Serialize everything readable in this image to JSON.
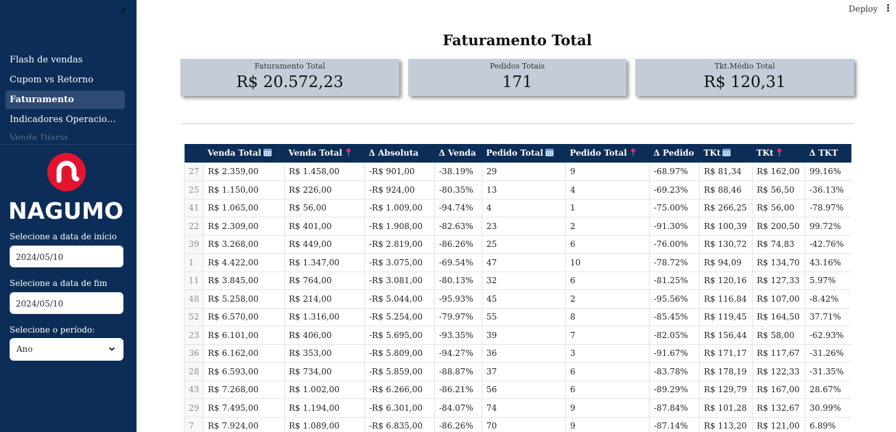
{
  "sidebar": {
    "close_label": "×",
    "nav": [
      {
        "label": "Flash de vendas",
        "active": false
      },
      {
        "label": "Cupom vs Retorno",
        "active": false
      },
      {
        "label": "Faturamento",
        "active": true
      },
      {
        "label": "Indicadores Operacionais ...",
        "active": false
      },
      {
        "label": "Venda Diaria",
        "active": false
      }
    ],
    "logo_text": "NAGUMO",
    "start_date": {
      "label": "Selecione a data de início",
      "value": "2024/05/10"
    },
    "end_date": {
      "label": "Selecione a data de fim",
      "value": "2024/05/10"
    },
    "period": {
      "label": "Selecione o período:",
      "value": "Ano"
    }
  },
  "topbar": {
    "deploy_label": "Deploy",
    "menu_icon": "kebab-menu-icon"
  },
  "page": {
    "title": "Faturamento Total"
  },
  "metrics": [
    {
      "label": "Faturamento Total",
      "value": "R$ 20.572,23"
    },
    {
      "label": "Pedidos Totais",
      "value": "171"
    },
    {
      "label": "Tkt.Médio Total",
      "value": "R$ 120,31"
    }
  ],
  "table": {
    "columns": [
      {
        "label": "Venda Total",
        "icon": "calendar-icon"
      },
      {
        "label": "Venda Total",
        "icon": "pin-icon"
      },
      {
        "label": "Δ Absoluta",
        "icon": ""
      },
      {
        "label": "Δ Venda",
        "icon": ""
      },
      {
        "label": "Pedido Total",
        "icon": "calendar-icon"
      },
      {
        "label": "Pedido Total",
        "icon": "pin-icon"
      },
      {
        "label": "Δ Pedido",
        "icon": ""
      },
      {
        "label": "TKt",
        "icon": "calendar-icon"
      },
      {
        "label": "TKt",
        "icon": "pin-icon"
      },
      {
        "label": "Δ TKT",
        "icon": ""
      }
    ],
    "rows": [
      [
        "27",
        "R$ 2.359,00",
        "R$ 1.458,00",
        "-R$ 901,00",
        "-38.19%",
        "29",
        "9",
        "-68.97%",
        "R$ 81,34",
        "R$ 162,00",
        "99.16%"
      ],
      [
        "25",
        "R$ 1.150,00",
        "R$ 226,00",
        "-R$ 924,00",
        "-80.35%",
        "13",
        "4",
        "-69.23%",
        "R$ 88,46",
        "R$ 56,50",
        "-36.13%"
      ],
      [
        "41",
        "R$ 1.065,00",
        "R$ 56,00",
        "-R$ 1.009,00",
        "-94.74%",
        "4",
        "1",
        "-75.00%",
        "R$ 266,25",
        "R$ 56,00",
        "-78.97%"
      ],
      [
        "22",
        "R$ 2.309,00",
        "R$ 401,00",
        "-R$ 1.908,00",
        "-82.63%",
        "23",
        "2",
        "-91.30%",
        "R$ 100,39",
        "R$ 200,50",
        "99.72%"
      ],
      [
        "39",
        "R$ 3.268,00",
        "R$ 449,00",
        "-R$ 2.819,00",
        "-86.26%",
        "25",
        "6",
        "-76.00%",
        "R$ 130,72",
        "R$ 74,83",
        "-42.76%"
      ],
      [
        "1",
        "R$ 4.422,00",
        "R$ 1.347,00",
        "-R$ 3.075,00",
        "-69.54%",
        "47",
        "10",
        "-78.72%",
        "R$ 94,09",
        "R$ 134,70",
        "43.16%"
      ],
      [
        "11",
        "R$ 3.845,00",
        "R$ 764,00",
        "-R$ 3.081,00",
        "-80.13%",
        "32",
        "6",
        "-81.25%",
        "R$ 120,16",
        "R$ 127,33",
        "5.97%"
      ],
      [
        "48",
        "R$ 5.258,00",
        "R$ 214,00",
        "-R$ 5.044,00",
        "-95.93%",
        "45",
        "2",
        "-95.56%",
        "R$ 116,84",
        "R$ 107,00",
        "-8.42%"
      ],
      [
        "52",
        "R$ 6.570,00",
        "R$ 1.316,00",
        "-R$ 5.254,00",
        "-79.97%",
        "55",
        "8",
        "-85.45%",
        "R$ 119,45",
        "R$ 164,50",
        "37.71%"
      ],
      [
        "23",
        "R$ 6.101,00",
        "R$ 406,00",
        "-R$ 5.695,00",
        "-93.35%",
        "39",
        "7",
        "-82.05%",
        "R$ 156,44",
        "R$ 58,00",
        "-62.93%"
      ],
      [
        "36",
        "R$ 6.162,00",
        "R$ 353,00",
        "-R$ 5.809,00",
        "-94.27%",
        "36",
        "3",
        "-91.67%",
        "R$ 171,17",
        "R$ 117,67",
        "-31.26%"
      ],
      [
        "28",
        "R$ 6.593,00",
        "R$ 734,00",
        "-R$ 5.859,00",
        "-88.87%",
        "37",
        "6",
        "-83.78%",
        "R$ 178,19",
        "R$ 122,33",
        "-31.35%"
      ],
      [
        "43",
        "R$ 7.268,00",
        "R$ 1.002,00",
        "-R$ 6.266,00",
        "-86.21%",
        "56",
        "6",
        "-89.29%",
        "R$ 129,79",
        "R$ 167,00",
        "28.67%"
      ],
      [
        "29",
        "R$ 7.495,00",
        "R$ 1.194,00",
        "-R$ 6.301,00",
        "-84.07%",
        "74",
        "9",
        "-87.84%",
        "R$ 101,28",
        "R$ 132,67",
        "30.99%"
      ],
      [
        "7",
        "R$ 7.924,00",
        "R$ 1.089,00",
        "-R$ 6.835,00",
        "-86.26%",
        "70",
        "9",
        "-87.14%",
        "R$ 113,20",
        "R$ 121,00",
        "6.89%"
      ]
    ]
  },
  "colors": {
    "sidebar_bg": "#0c2d57",
    "accent_red": "#e3142f",
    "metric_bg": "#c3ccd8",
    "header_bg": "#0c2d57"
  }
}
